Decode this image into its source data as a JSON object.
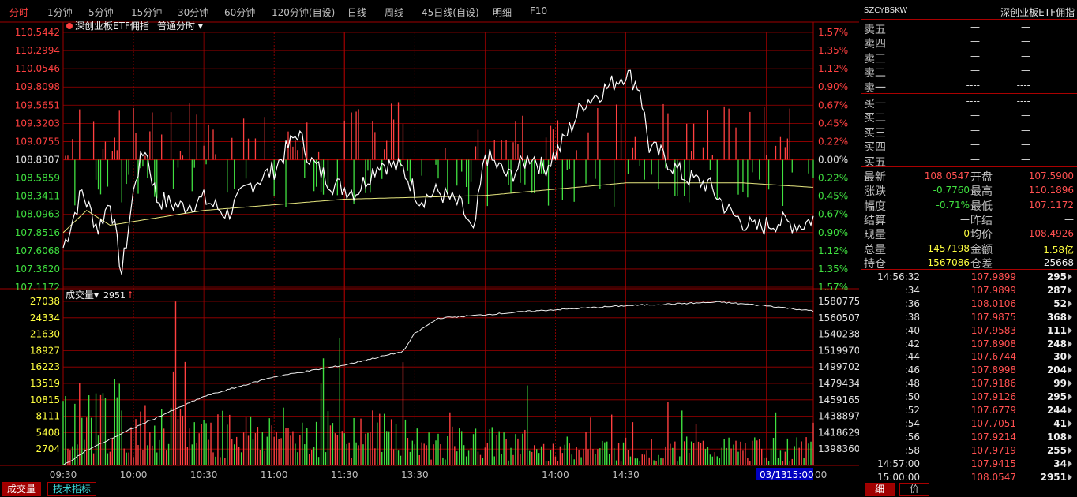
{
  "tabs": [
    "分时",
    "1分钟",
    "5分钟",
    "15分钟",
    "30分钟",
    "60分钟",
    "120分钟(自设)",
    "日线",
    "周线",
    "45日线(自设)",
    "明细",
    "F10"
  ],
  "active_tab": 0,
  "chart": {
    "title": "深创业板ETF佣指",
    "mode": "普通分时",
    "volume_label": "成交量",
    "volume_value": "2951",
    "price_ticks": [
      "110.5442",
      "110.2994",
      "110.0546",
      "109.8098",
      "109.5651",
      "109.3203",
      "109.0755",
      "108.8307",
      "108.5859",
      "108.3411",
      "108.0963",
      "107.8516",
      "107.6068",
      "107.3620",
      "107.1172"
    ],
    "pct_ticks": [
      "1.57%",
      "1.35%",
      "1.12%",
      "0.90%",
      "0.67%",
      "0.45%",
      "0.22%",
      "0.00%",
      "0.22%",
      "0.45%",
      "0.67%",
      "0.90%",
      "1.12%",
      "1.35%",
      "1.57%"
    ],
    "vol_ticks": [
      "27038",
      "24334",
      "21630",
      "18927",
      "16223",
      "13519",
      "10815",
      "8111",
      "5408",
      "2704"
    ],
    "oi_ticks": [
      "1580775",
      "1560507",
      "1540238",
      "1519970",
      "1499702",
      "1479434",
      "1459165",
      "1438897",
      "1418629",
      "1398360"
    ],
    "time_labels": [
      "09:30",
      "10:00",
      "10:30",
      "11:00",
      "11:30",
      "13:30",
      "14:00",
      "14:30",
      "15:00"
    ],
    "date_badge": "03/13",
    "time_end": "15:00",
    "time_end2": "00"
  },
  "chart_data": {
    "type": "line",
    "title": "深创业板ETF佣指",
    "x_range": [
      "09:30",
      "15:00"
    ],
    "reference_price": 108.8307,
    "price_range": [
      107.1172,
      110.5442
    ],
    "price_keypoints": [
      {
        "t": 0,
        "p": 107.65
      },
      {
        "t": 8,
        "p": 108.4
      },
      {
        "t": 15,
        "p": 107.9
      },
      {
        "t": 20,
        "p": 108.3
      },
      {
        "t": 25,
        "p": 107.3
      },
      {
        "t": 31,
        "p": 108.6
      },
      {
        "t": 35,
        "p": 109.0
      },
      {
        "t": 40,
        "p": 108.3
      },
      {
        "t": 50,
        "p": 108.2
      },
      {
        "t": 60,
        "p": 108.3
      },
      {
        "t": 70,
        "p": 108.1
      },
      {
        "t": 80,
        "p": 108.5
      },
      {
        "t": 90,
        "p": 108.7
      },
      {
        "t": 100,
        "p": 109.2
      },
      {
        "t": 106,
        "p": 108.8
      },
      {
        "t": 115,
        "p": 108.5
      },
      {
        "t": 125,
        "p": 108.4
      },
      {
        "t": 135,
        "p": 108.8
      },
      {
        "t": 145,
        "p": 108.7
      },
      {
        "t": 152,
        "p": 108.3
      },
      {
        "t": 160,
        "p": 108.4
      },
      {
        "t": 170,
        "p": 108.2
      },
      {
        "t": 175,
        "p": 107.8
      },
      {
        "t": 180,
        "p": 108.9
      },
      {
        "t": 190,
        "p": 108.6
      },
      {
        "t": 200,
        "p": 108.9
      },
      {
        "t": 205,
        "p": 108.7
      },
      {
        "t": 212,
        "p": 109.0
      },
      {
        "t": 222,
        "p": 109.6
      },
      {
        "t": 232,
        "p": 109.8
      },
      {
        "t": 240,
        "p": 110.0
      },
      {
        "t": 246,
        "p": 109.8
      },
      {
        "t": 250,
        "p": 109.0
      },
      {
        "t": 255,
        "p": 108.9
      },
      {
        "t": 265,
        "p": 108.6
      },
      {
        "t": 275,
        "p": 108.5
      },
      {
        "t": 285,
        "p": 108.1
      },
      {
        "t": 295,
        "p": 107.9
      },
      {
        "t": 305,
        "p": 108.0
      },
      {
        "t": 315,
        "p": 107.95
      },
      {
        "t": 320,
        "p": 108.05
      }
    ],
    "avg_keypoints": [
      {
        "t": 0,
        "p": 107.85
      },
      {
        "t": 10,
        "p": 108.15
      },
      {
        "t": 20,
        "p": 107.95
      },
      {
        "t": 30,
        "p": 108.0
      },
      {
        "t": 60,
        "p": 108.15
      },
      {
        "t": 120,
        "p": 108.3
      },
      {
        "t": 180,
        "p": 108.35
      },
      {
        "t": 240,
        "p": 108.52
      },
      {
        "t": 290,
        "p": 108.52
      },
      {
        "t": 320,
        "p": 108.46
      }
    ],
    "volume_range": [
      0,
      27038
    ],
    "oi_range": [
      1398360,
      1580775
    ],
    "oi_keypoints": [
      {
        "t": 0,
        "p": 1398360
      },
      {
        "t": 10,
        "p": 1415000
      },
      {
        "t": 30,
        "p": 1440000
      },
      {
        "t": 60,
        "p": 1475000
      },
      {
        "t": 90,
        "p": 1497000
      },
      {
        "t": 120,
        "p": 1510000
      },
      {
        "t": 145,
        "p": 1525000
      },
      {
        "t": 150,
        "p": 1545000
      },
      {
        "t": 160,
        "p": 1562000
      },
      {
        "t": 200,
        "p": 1570000
      },
      {
        "t": 240,
        "p": 1576000
      },
      {
        "t": 280,
        "p": 1580000
      },
      {
        "t": 300,
        "p": 1576000
      },
      {
        "t": 320,
        "p": 1570000
      }
    ]
  },
  "sidebar": {
    "code": "SZCYBSKW",
    "name": "深创业板ETF佣指",
    "asks": [
      {
        "label": "卖五",
        "price": "—",
        "vol": "—"
      },
      {
        "label": "卖四",
        "price": "—",
        "vol": "—"
      },
      {
        "label": "卖三",
        "price": "—",
        "vol": "—"
      },
      {
        "label": "卖二",
        "price": "—",
        "vol": "—"
      },
      {
        "label": "卖一",
        "price": "----",
        "vol": "----"
      }
    ],
    "bids": [
      {
        "label": "买一",
        "price": "----",
        "vol": "----"
      },
      {
        "label": "买二",
        "price": "—",
        "vol": "—"
      },
      {
        "label": "买三",
        "price": "—",
        "vol": "—"
      },
      {
        "label": "买四",
        "price": "—",
        "vol": "—"
      },
      {
        "label": "买五",
        "price": "—",
        "vol": "—"
      }
    ],
    "quote": [
      {
        "l1": "最新",
        "v1": "108.0547",
        "c1": "#ff5050",
        "l2": "开盘",
        "v2": "107.5900",
        "c2": "#ff5050"
      },
      {
        "l1": "涨跌",
        "v1": "-0.7760",
        "c1": "#40e040",
        "l2": "最高",
        "v2": "110.1896",
        "c2": "#ff5050"
      },
      {
        "l1": "幅度",
        "v1": "-0.71%",
        "c1": "#40e040",
        "l2": "最低",
        "v2": "107.1172",
        "c2": "#ff5050"
      },
      {
        "l1": "结算",
        "v1": "—",
        "c1": "#e0e0e0",
        "l2": "昨结",
        "v2": "—",
        "c2": "#e0e0e0"
      },
      {
        "l1": "现量",
        "v1": "0",
        "c1": "#ffff40",
        "l2": "均价",
        "v2": "108.4926",
        "c2": "#ff5050"
      },
      {
        "l1": "总量",
        "v1": "1457198",
        "c1": "#ffff40",
        "l2": "金额",
        "v2": "1.58亿",
        "c2": "#ffff40"
      },
      {
        "l1": "持仓",
        "v1": "1567086",
        "c1": "#ffff40",
        "l2": "仓差",
        "v2": "-25668",
        "c2": "#f0f0f0"
      }
    ],
    "trades": [
      {
        "t": "14:56:32",
        "p": "107.9899",
        "v": "295"
      },
      {
        "t": ":34",
        "p": "107.9899",
        "v": "287"
      },
      {
        "t": ":36",
        "p": "108.0106",
        "v": "52"
      },
      {
        "t": ":38",
        "p": "107.9875",
        "v": "368"
      },
      {
        "t": ":40",
        "p": "107.9583",
        "v": "111"
      },
      {
        "t": ":42",
        "p": "107.8908",
        "v": "248"
      },
      {
        "t": ":44",
        "p": "107.6744",
        "v": "30"
      },
      {
        "t": ":46",
        "p": "107.8998",
        "v": "204"
      },
      {
        "t": ":48",
        "p": "107.9186",
        "v": "99"
      },
      {
        "t": ":50",
        "p": "107.9126",
        "v": "295"
      },
      {
        "t": ":52",
        "p": "107.6779",
        "v": "244"
      },
      {
        "t": ":54",
        "p": "107.7051",
        "v": "41"
      },
      {
        "t": ":56",
        "p": "107.9214",
        "v": "108"
      },
      {
        "t": ":58",
        "p": "107.9719",
        "v": "255"
      },
      {
        "t": "14:57:00",
        "p": "107.9415",
        "v": "34"
      },
      {
        "t": "15:00:00",
        "p": "108.0547",
        "v": "2951"
      }
    ],
    "tab_detail": "细",
    "tab_price": "价"
  },
  "bottom": {
    "tab_volume": "成交量",
    "tab_tech": "技术指标"
  },
  "colors": {
    "up": "#ff4040",
    "down": "#40e040",
    "grid": "#a00000",
    "avg": "#e8e880",
    "line": "#ffffff"
  }
}
